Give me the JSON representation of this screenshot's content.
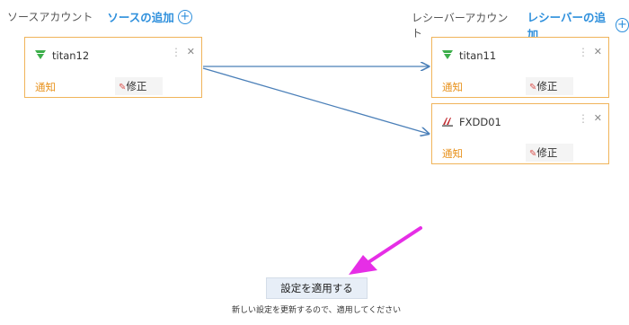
{
  "source": {
    "label": "ソースアカウント",
    "add_label": "ソースの追加",
    "cards": [
      {
        "name": "titan12",
        "notify": "通知",
        "edit": "修正",
        "logo": "titan-logo-icon"
      }
    ]
  },
  "receiver": {
    "label": "レシーバーアカウント",
    "add_label": "レシーバーの追加",
    "cards": [
      {
        "name": "titan11",
        "notify": "通知",
        "edit": "修正",
        "logo": "titan-logo-icon"
      },
      {
        "name": "FXDD01",
        "notify": "通知",
        "edit": "修正",
        "logo": "fxdd-logo-icon"
      }
    ]
  },
  "apply_button": "設定を適用する",
  "hint": "新しい設定を更新するので、適用してください",
  "colors": {
    "accent": "#2d8fdc",
    "card_border": "#f0b45a",
    "notify": "#e8921d",
    "arrow_annotation": "#e62ee6"
  }
}
